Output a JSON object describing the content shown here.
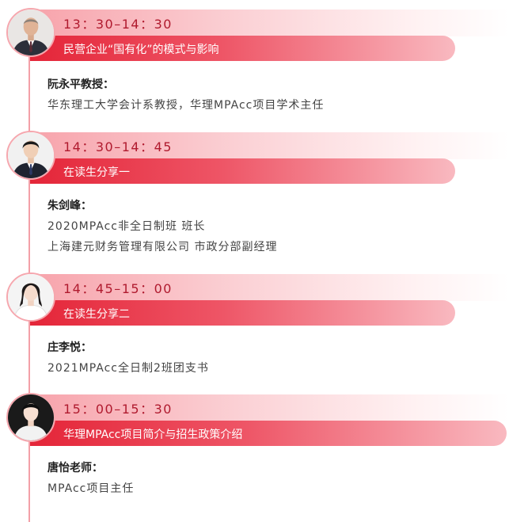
{
  "sessions": [
    {
      "time": "13：30–14：30",
      "title": "民营企业“国有化”的模式与影响",
      "speaker": "阮永平教授：",
      "lines": [
        "华东理工大学会计系教授，华理MPAcc项目学术主任"
      ]
    },
    {
      "time": "14：30–14：45",
      "title": "在读生分享一",
      "speaker": "朱剑峰：",
      "lines": [
        "2020MPAcc非全日制班 班长",
        "上海建元财务管理有限公司 市政分部副经理"
      ]
    },
    {
      "time": "14：45–15：00",
      "title": "在读生分享二",
      "speaker": "庄李悦：",
      "lines": [
        "2021MPAcc全日制2班团支书"
      ]
    },
    {
      "time": "15：00–15：30",
      "title": "华理MPAcc项目简介与招生政策介绍",
      "speaker": "唐怡老师：",
      "lines": [
        "MPAcc项目主任"
      ]
    }
  ],
  "colors": {
    "accent": "#e42538",
    "time_text": "#b01a2e",
    "timeline": "#f3a0a8"
  }
}
